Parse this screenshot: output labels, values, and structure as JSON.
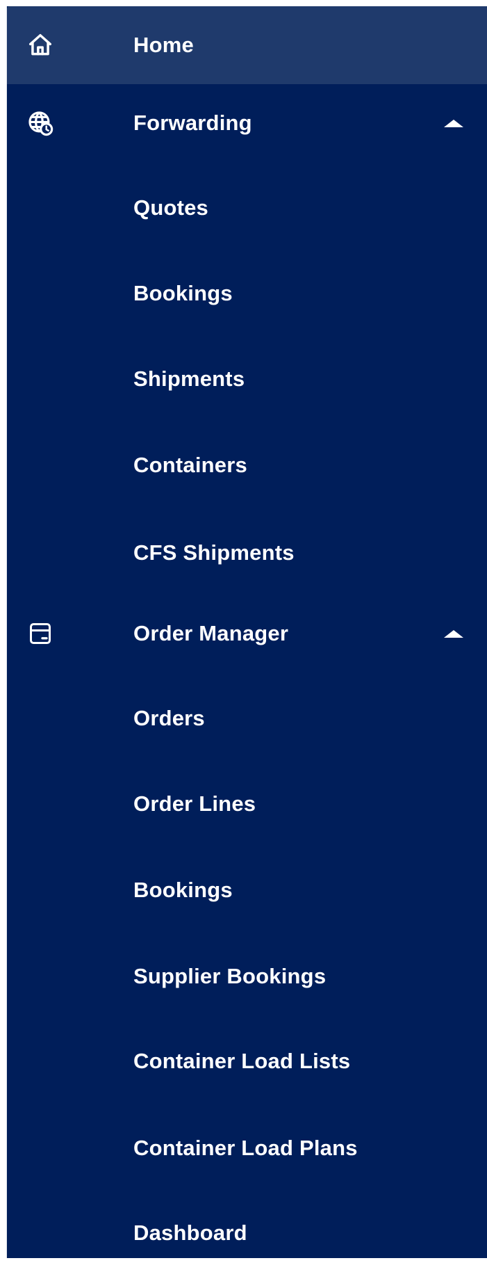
{
  "sidebar": {
    "colors": {
      "background": "#001e5a",
      "active": "#1f3a6c",
      "text": "#ffffff"
    },
    "home": {
      "label": "Home",
      "icon": "home-icon"
    },
    "forwarding": {
      "label": "Forwarding",
      "icon": "globe-clock-icon",
      "expanded": true,
      "items": [
        "Quotes",
        "Bookings",
        "Shipments",
        "Containers",
        "CFS Shipments"
      ]
    },
    "order_manager": {
      "label": "Order Manager",
      "icon": "package-box-icon",
      "expanded": true,
      "items": [
        "Orders",
        "Order Lines",
        "Bookings",
        "Supplier Bookings",
        "Container Load Lists",
        "Container Load Plans",
        "Dashboard"
      ]
    }
  }
}
